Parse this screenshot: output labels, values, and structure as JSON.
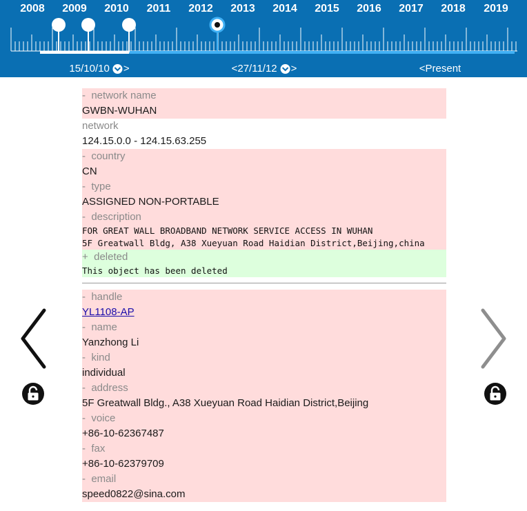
{
  "timeline": {
    "years": [
      "2008",
      "2009",
      "2010",
      "2011",
      "2012",
      "2013",
      "2014",
      "2015",
      "2016",
      "2017",
      "2018",
      "2019"
    ],
    "markers": [
      {
        "label": "15/10/10",
        "prefix": ""
      },
      {
        "label": "27/11/12",
        "prefix": "<"
      },
      {
        "label": "Present",
        "prefix": "<"
      }
    ],
    "colors": {
      "background": "#0a6fb3",
      "range": "#3fb0f5",
      "base": "#ffffff"
    }
  },
  "record": {
    "network_name": {
      "marker": "-",
      "label": "network name",
      "value": "GWBN-WUHAN"
    },
    "network": {
      "label": "network",
      "value": "124.15.0.0 - 124.15.63.255"
    },
    "country": {
      "marker": "-",
      "label": "country",
      "value": "CN"
    },
    "type": {
      "marker": "-",
      "label": "type",
      "value": "ASSIGNED NON-PORTABLE"
    },
    "description": {
      "marker": "-",
      "label": "description",
      "lines": [
        "FOR GREAT WALL BROADBAND NETWORK SERVICE ACCESS IN WUHAN",
        "5F Greatwall Bldg, A38 Xueyuan Road Haidian District,Beijing,china"
      ]
    },
    "deleted": {
      "marker": "+",
      "label": "deleted",
      "value": "This object has been deleted"
    }
  },
  "contact": {
    "handle": {
      "marker": "-",
      "label": "handle",
      "value": "YL1108-AP"
    },
    "name": {
      "marker": "-",
      "label": "name",
      "value": "Yanzhong Li"
    },
    "kind": {
      "marker": "-",
      "label": "kind",
      "value": "individual"
    },
    "address": {
      "marker": "-",
      "label": "address",
      "value": "5F Greatwall Bldg., A38 Xueyuan Road Haidian District,Beijing"
    },
    "voice": {
      "marker": "-",
      "label": "voice",
      "value": "+86-10-62367487"
    },
    "fax": {
      "marker": "-",
      "label": "fax",
      "value": "+86-10-62379709"
    },
    "email": {
      "marker": "-",
      "label": "email",
      "value": "speed0822@sina.com"
    }
  },
  "icons": {
    "prev": "chevron-left-icon",
    "next": "chevron-right-icon",
    "lock_left": "unlock-icon",
    "lock_right": "unlock-icon"
  },
  "colors": {
    "removed": "#ffdcdc",
    "added": "#ddffdd",
    "link": "#1a0dab"
  }
}
